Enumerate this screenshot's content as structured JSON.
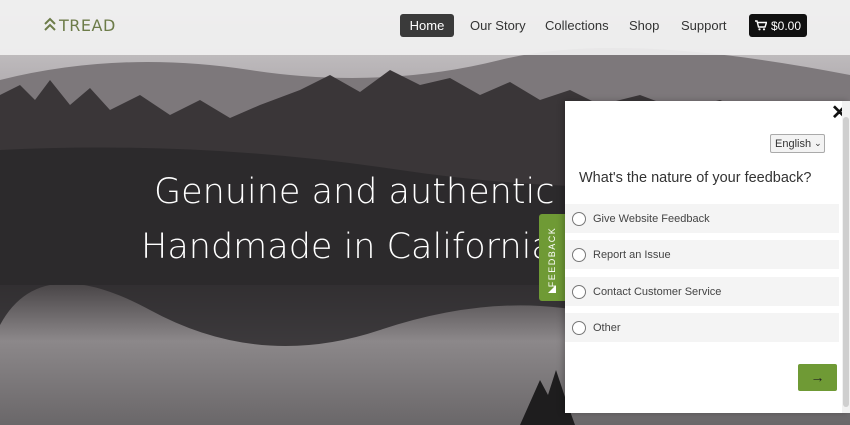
{
  "brand": {
    "name": "TREAD",
    "accent": "#6d7c49"
  },
  "nav": {
    "items": [
      "Home",
      "Our Story",
      "Collections",
      "Shop",
      "Support"
    ],
    "active": "Home",
    "cart_label": "$0.00",
    "cart_icon": "cart-icon"
  },
  "hero": {
    "line1": "Genuine and authentic su",
    "line2": "Handmade in California s"
  },
  "feedback_tab": {
    "label": "FEEDBACK",
    "color": "#6f9a35"
  },
  "feedback_panel": {
    "language": "English",
    "question": "What's the nature of your feedback?",
    "options": [
      "Give Website Feedback",
      "Report an Issue",
      "Contact Customer Service",
      "Other"
    ],
    "next_label": "→",
    "close_label": "✕"
  }
}
